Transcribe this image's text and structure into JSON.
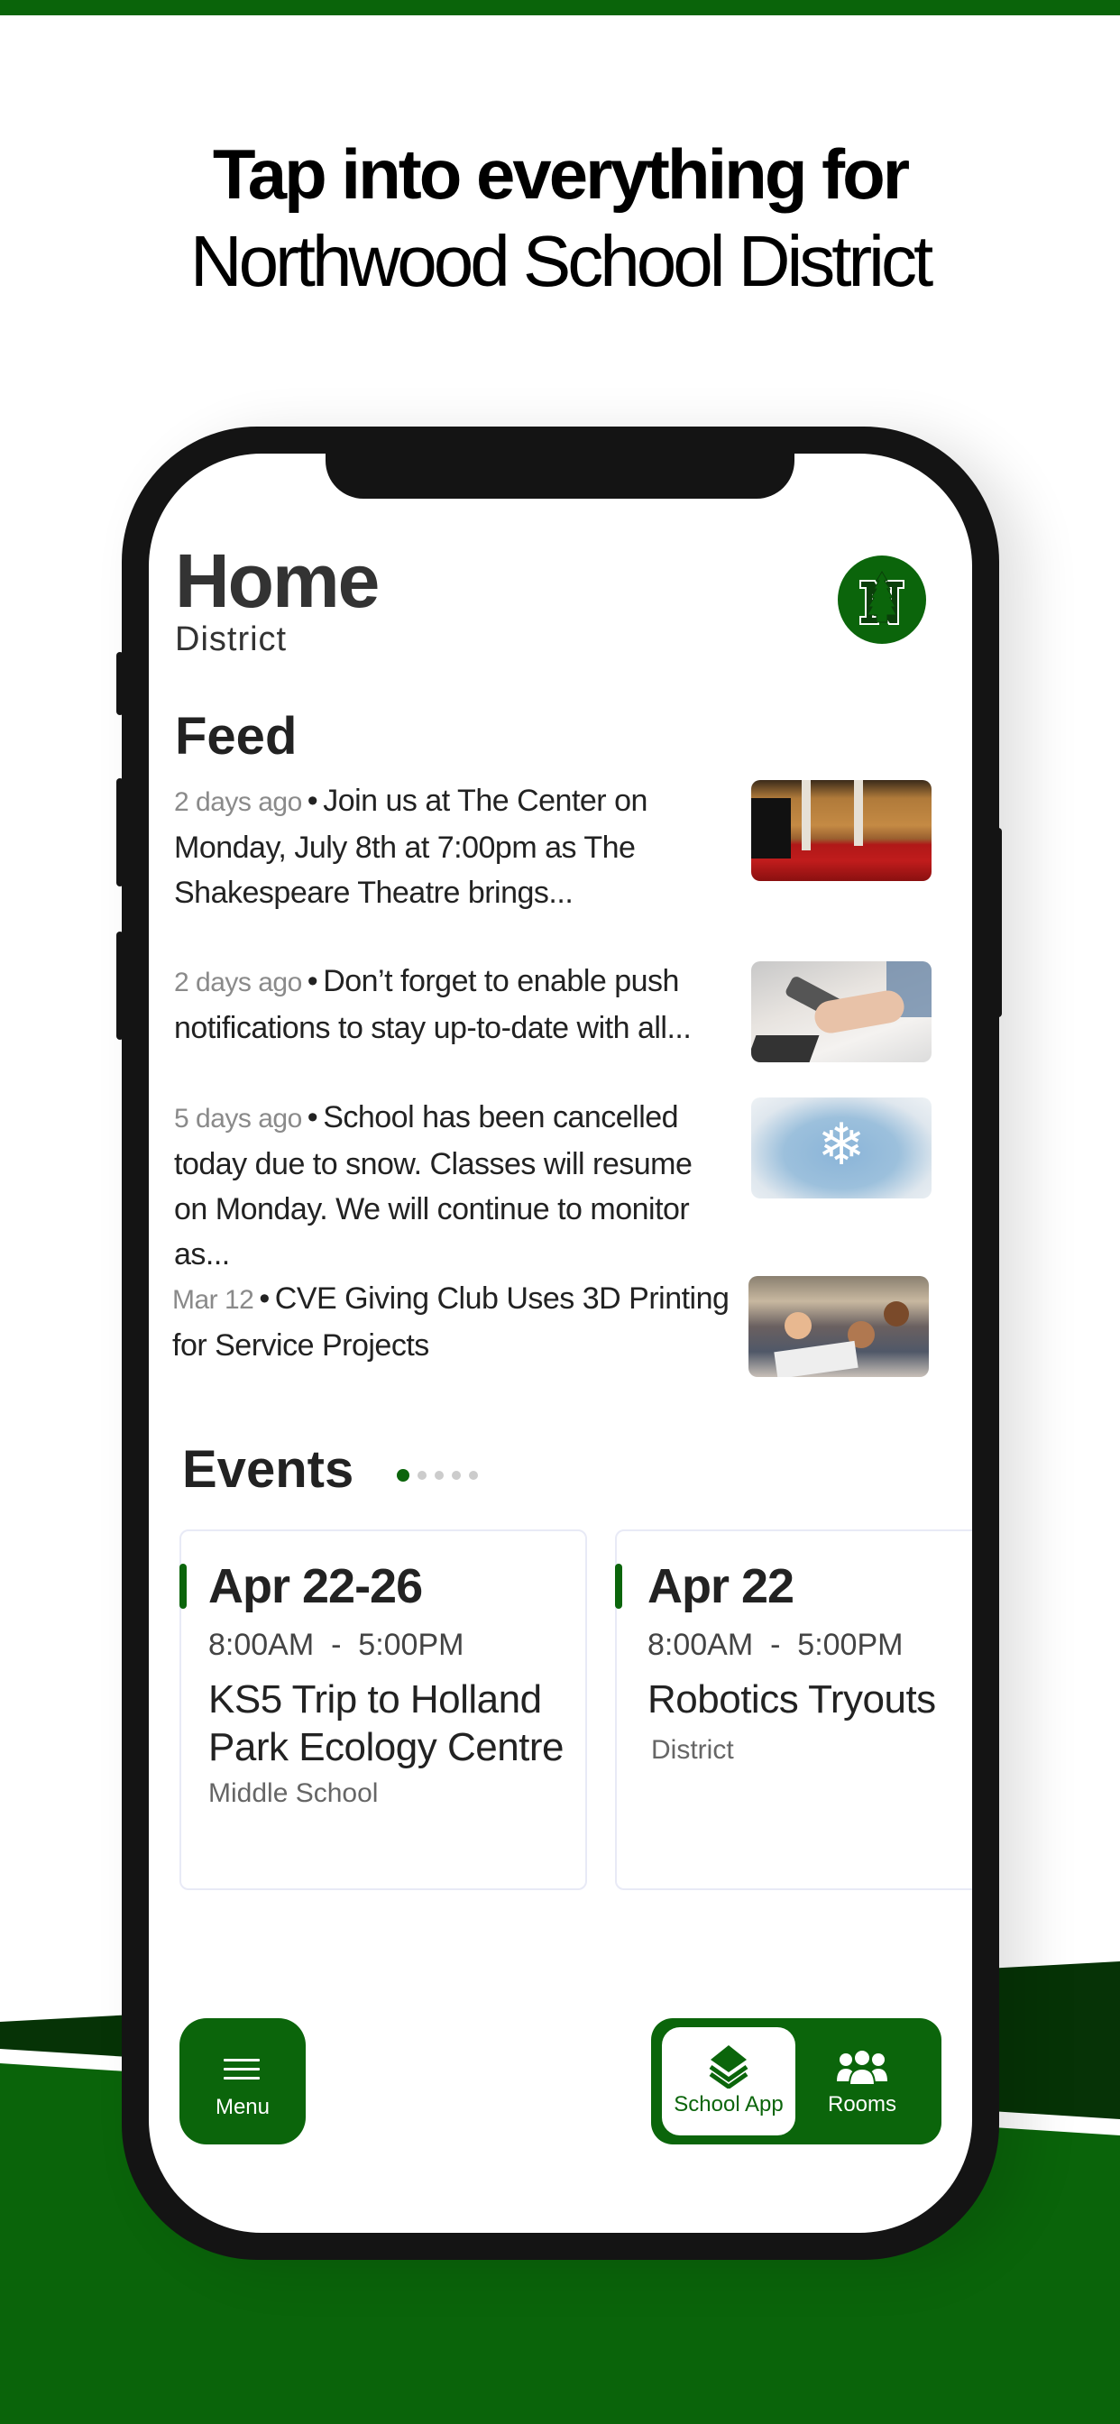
{
  "colors": {
    "brand_green": "#0b650b",
    "dark_green": "#063306",
    "phone_frame": "#141414"
  },
  "hero": {
    "line1": "Tap into everything for",
    "line2": "Northwood School District"
  },
  "header": {
    "title": "Home",
    "subtitle": "District",
    "logo_icon": "northwood-n-tree-logo"
  },
  "feed": {
    "title": "Feed",
    "items": [
      {
        "time": "2 days ago",
        "text": "Join us at The Center on Monday, July 8th at 7:00pm as The Shakespeare Theatre brings...",
        "image": "theatre-seats-photo"
      },
      {
        "time": "2 days ago",
        "text": "Don’t forget to enable push notifications to stay up-to-date with all...",
        "image": "hands-phone-photo"
      },
      {
        "time": "5 days ago",
        "text": "School has been cancelled today due to snow. Classes will resume on Monday. We will continue to monitor as...",
        "image": "mittens-snowflake-photo"
      },
      {
        "time": "Mar 12",
        "text": "CVE Giving Club Uses 3D Printing for Service Projects",
        "image": "classroom-kids-photo"
      }
    ],
    "separator": "•"
  },
  "events": {
    "title": "Events",
    "pager": {
      "total": 5,
      "active_index": 0
    },
    "items": [
      {
        "date": "Apr 22-26",
        "time": "8:00AM  -  5:00PM",
        "name": "KS5 Trip to Holland Park Ecology Centre",
        "location": "Middle School"
      },
      {
        "date": "Apr 22",
        "time": "8:00AM  -  5:00PM",
        "name": "Robotics Tryouts",
        "location": "District"
      }
    ]
  },
  "bottom_nav": {
    "menu_label": "Menu",
    "menu_icon": "hamburger-icon",
    "segments": [
      {
        "label": "School App",
        "icon": "layers-icon",
        "active": true
      },
      {
        "label": "Rooms",
        "icon": "group-icon",
        "active": false
      }
    ]
  }
}
